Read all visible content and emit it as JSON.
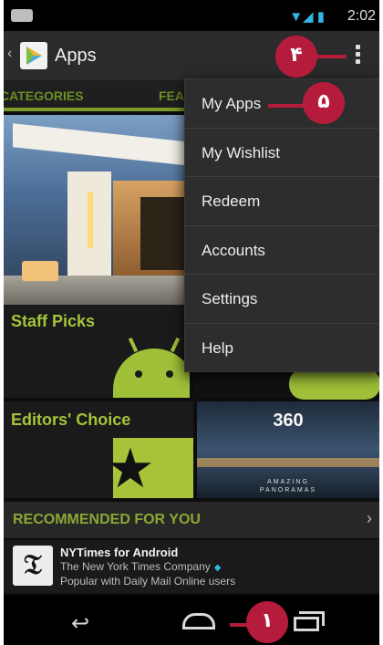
{
  "status_bar": {
    "time": "2:02"
  },
  "action_bar": {
    "title": "Apps"
  },
  "tabs": [
    {
      "label": "CATEGORIES"
    },
    {
      "label": "FEA"
    }
  ],
  "tiles": {
    "staff_picks": "Staff Picks",
    "editors_choice": "Editors' Choice",
    "panorama": {
      "title": "360",
      "subtitle_line1": "AMAZING",
      "subtitle_line2": "PANORAMAS"
    }
  },
  "recommended": {
    "header": "RECOMMENDED FOR YOU",
    "items": [
      {
        "name": "NYTimes for Android",
        "developer": "The New York Times Company",
        "note": "Popular with Daily Mail Online users",
        "logo_glyph": "𝔗"
      }
    ]
  },
  "menu": {
    "items": [
      "My Apps",
      "My Wishlist",
      "Redeem",
      "Accounts",
      "Settings",
      "Help"
    ]
  },
  "callouts": [
    {
      "label": "۴"
    },
    {
      "label": "۵"
    },
    {
      "label": "۱"
    }
  ],
  "colors": {
    "accent_green": "#9fc038",
    "callout": "#b51c3c",
    "holo_blue": "#33b5e5"
  },
  "icons": [
    "notification-icon",
    "wifi-icon",
    "signal-icon",
    "battery-icon",
    "up-arrow-icon",
    "play-store-icon",
    "overflow-menu-icon",
    "chevron-right-icon",
    "verified-icon",
    "back-icon",
    "home-icon",
    "recent-apps-icon"
  ]
}
